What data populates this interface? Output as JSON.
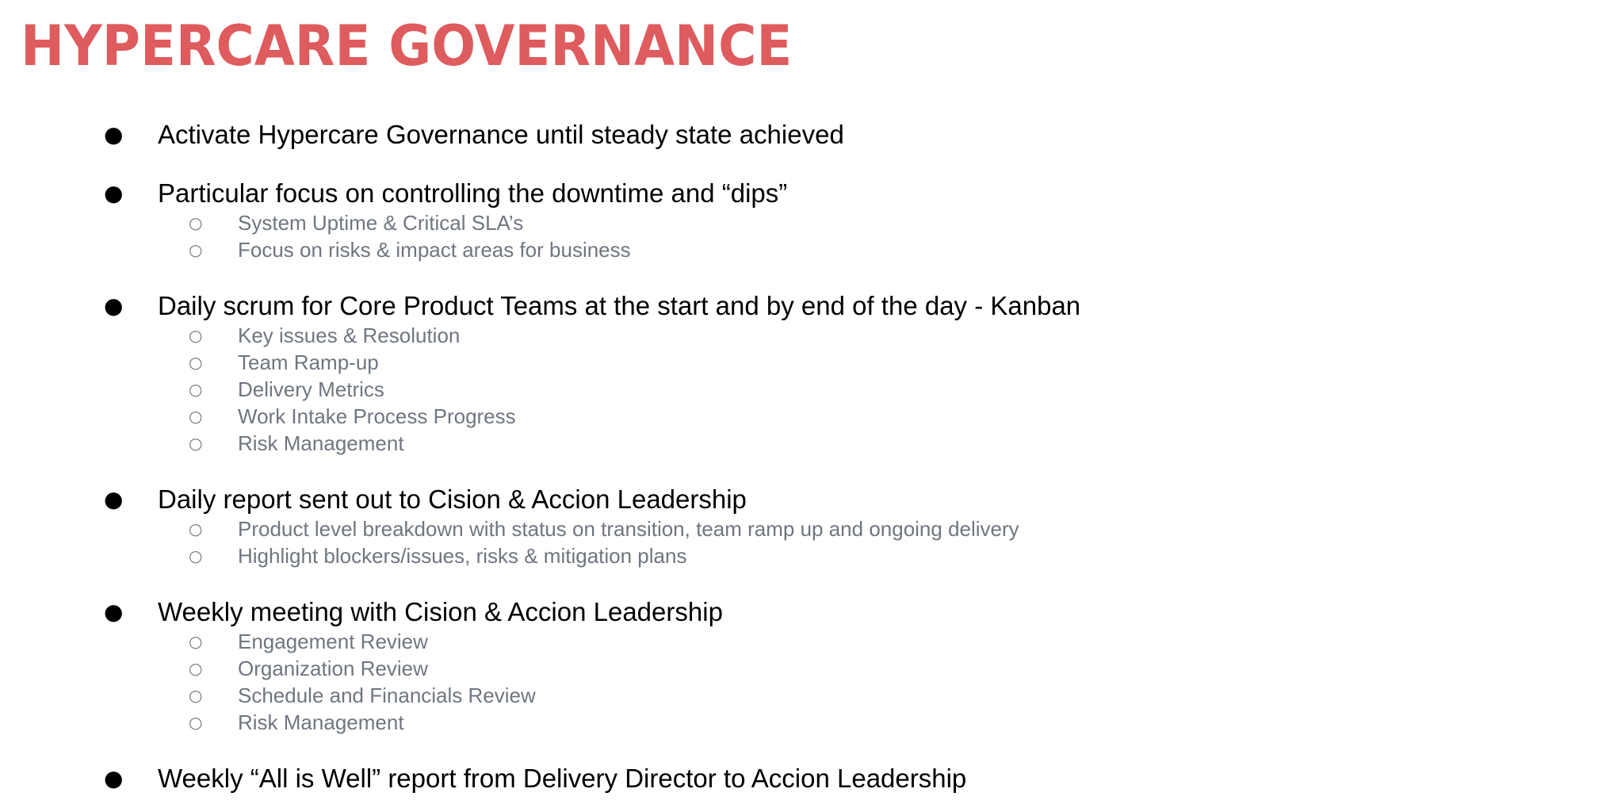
{
  "slide": {
    "title": "HYPERCARE GOVERNANCE",
    "colors": {
      "title": "#de5b5e",
      "bullet_text": "#000000",
      "sub_text": "#6f7680"
    },
    "bullet_glyph": "●",
    "sub_glyph": "○",
    "bullets": [
      {
        "text": "Activate Hypercare Governance until steady state achieved",
        "sub": []
      },
      {
        "text": "Particular focus on controlling the downtime and “dips”",
        "sub": [
          "System Uptime & Critical SLA’s",
          "Focus on risks & impact areas for business"
        ]
      },
      {
        "text": "Daily scrum for Core Product Teams at the start and by end of the day - Kanban",
        "sub": [
          "Key issues & Resolution",
          "Team Ramp-up",
          "Delivery Metrics",
          "Work Intake Process Progress",
          "Risk Management"
        ]
      },
      {
        "text": "Daily report sent out to Cision & Accion Leadership",
        "sub": [
          "Product level breakdown with status on transition, team ramp up and ongoing delivery",
          "Highlight blockers/issues, risks  & mitigation plans"
        ]
      },
      {
        "text": "Weekly meeting with Cision & Accion Leadership",
        "sub": [
          "Engagement Review",
          "Organization Review",
          "Schedule and Financials Review",
          "Risk Management"
        ]
      },
      {
        "text": "Weekly “All is Well” report from Delivery Director to Accion Leadership",
        "sub": []
      }
    ]
  }
}
